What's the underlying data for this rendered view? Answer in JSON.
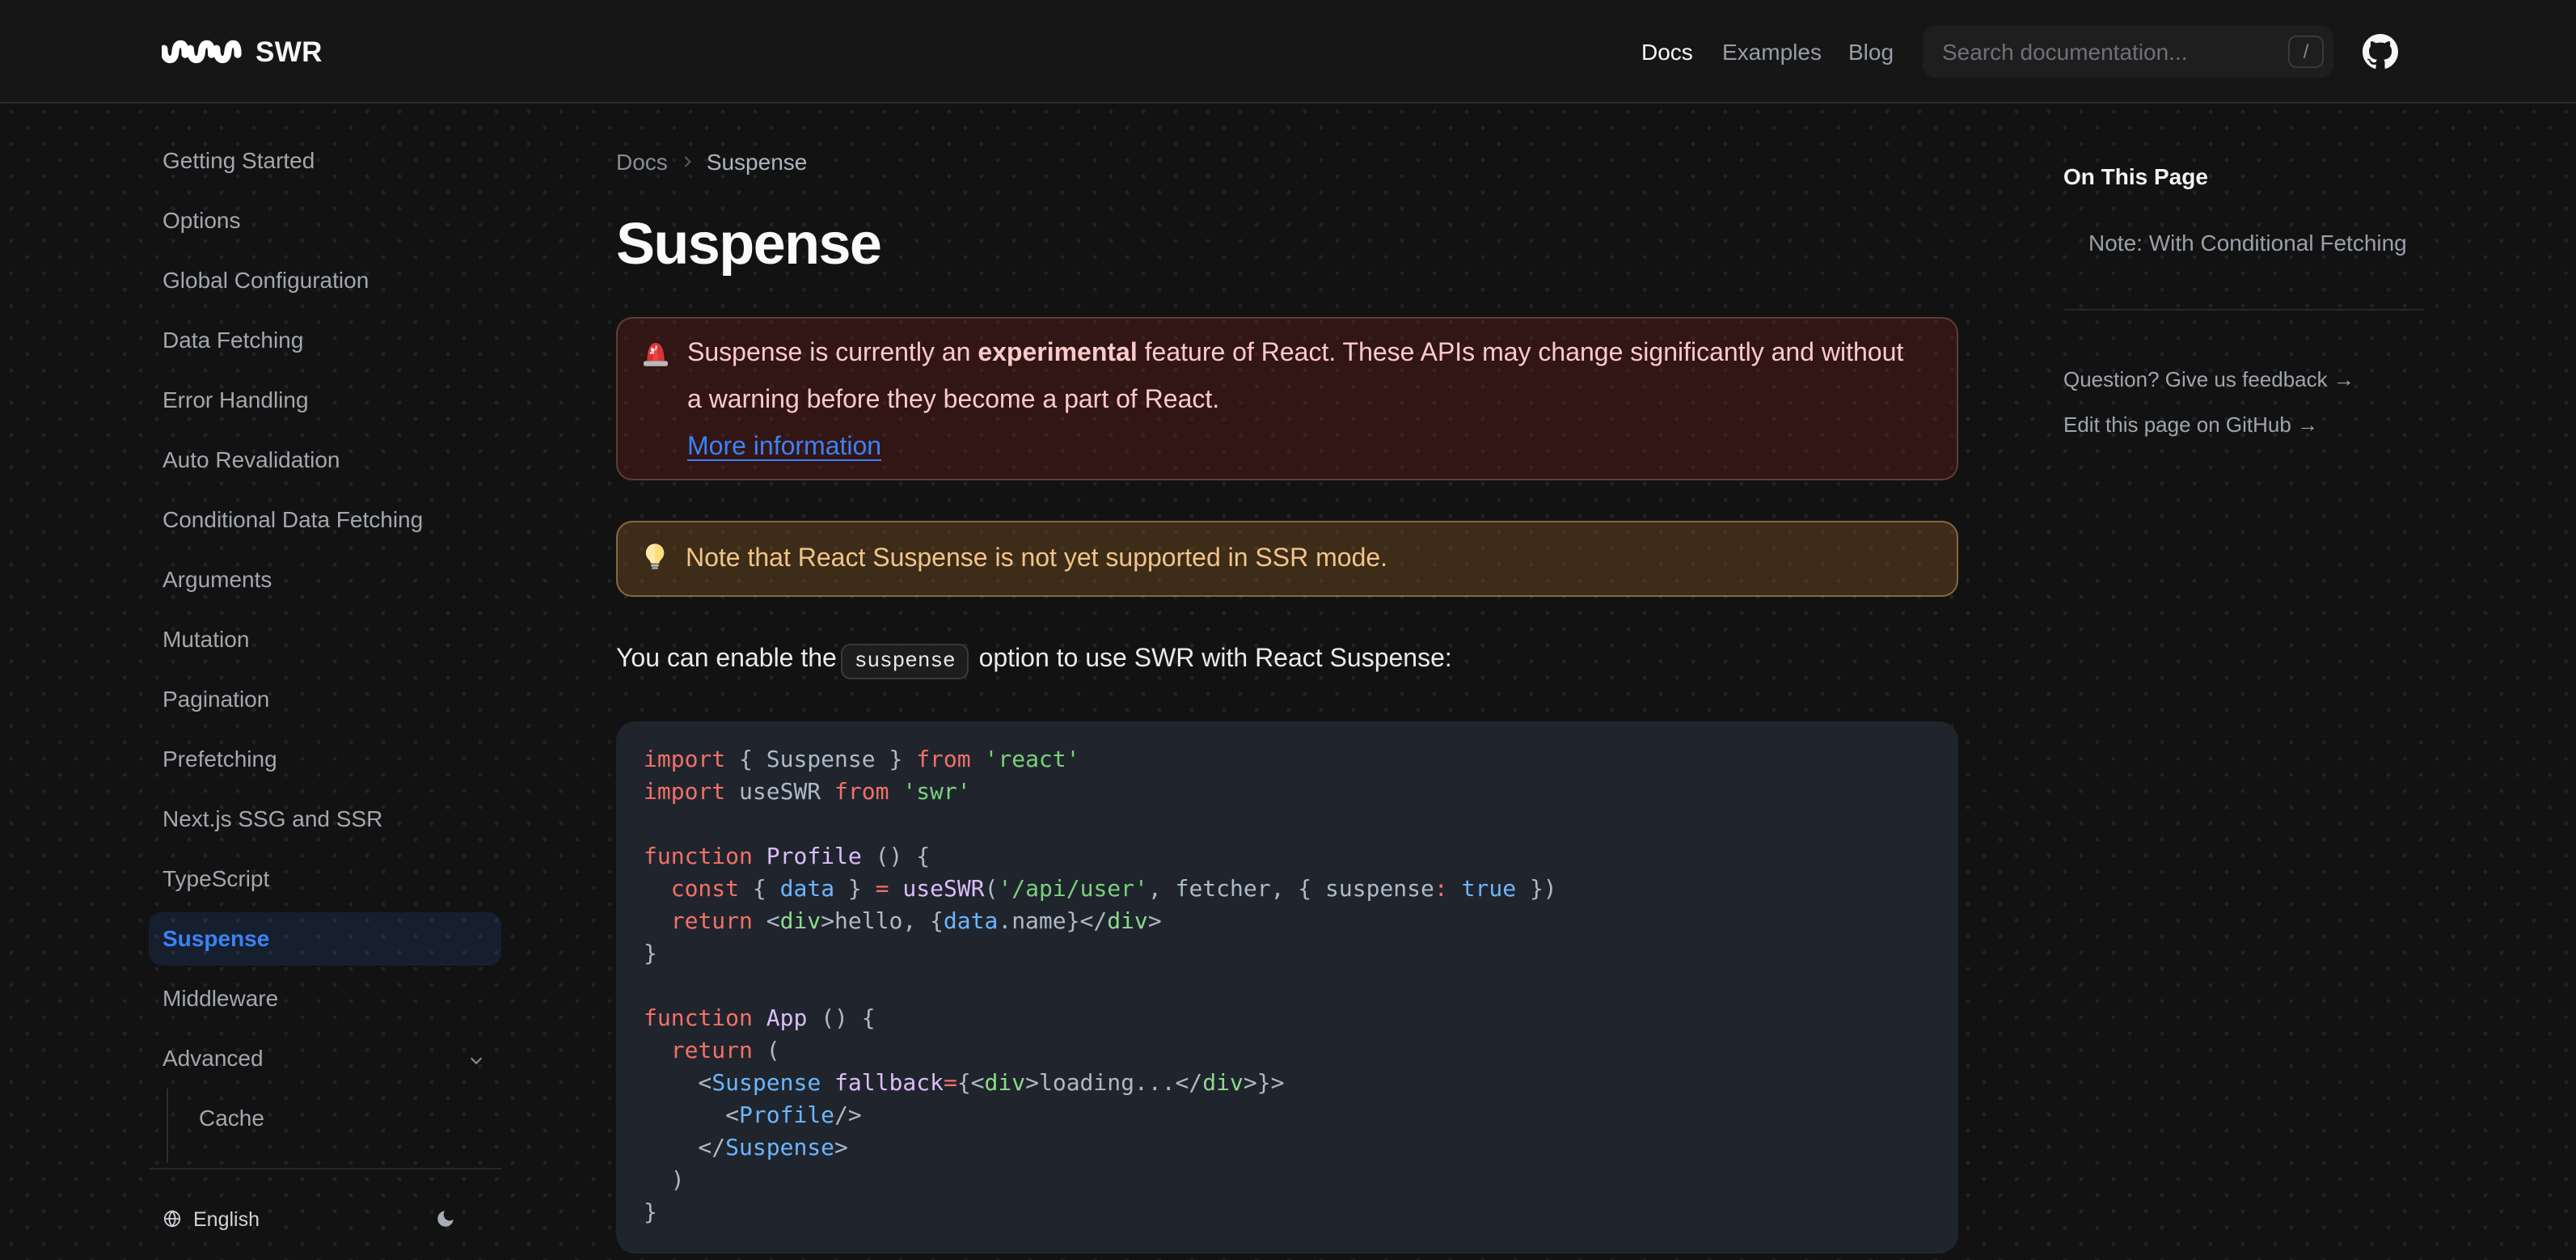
{
  "navbar": {
    "logo_text": "SWR",
    "links": [
      {
        "label": "Docs",
        "active": true
      },
      {
        "label": "Examples",
        "active": false
      },
      {
        "label": "Blog",
        "active": false
      }
    ],
    "search": {
      "placeholder": "Search documentation...",
      "kbd": "/"
    }
  },
  "sidebar": {
    "items": [
      {
        "label": "Getting Started"
      },
      {
        "label": "Options"
      },
      {
        "label": "Global Configuration"
      },
      {
        "label": "Data Fetching"
      },
      {
        "label": "Error Handling"
      },
      {
        "label": "Auto Revalidation"
      },
      {
        "label": "Conditional Data Fetching"
      },
      {
        "label": "Arguments"
      },
      {
        "label": "Mutation"
      },
      {
        "label": "Pagination"
      },
      {
        "label": "Prefetching"
      },
      {
        "label": "Next.js SSG and SSR"
      },
      {
        "label": "TypeScript"
      },
      {
        "label": "Suspense",
        "active": true
      },
      {
        "label": "Middleware"
      },
      {
        "label": "Advanced",
        "expandable": true
      }
    ],
    "nested_items": [
      {
        "label": "Cache"
      }
    ],
    "footer": {
      "language": "English"
    }
  },
  "breadcrumb": {
    "section": "Docs",
    "page": "Suspense"
  },
  "page": {
    "title": "Suspense"
  },
  "callouts": {
    "error": {
      "text_before": "Suspense is currently an ",
      "bold": "experimental",
      "text_after": " feature of React. These APIs may change significantly and without a warning before they become a part of React.",
      "link": "More information"
    },
    "warning": {
      "text": "Note that React Suspense is not yet supported in SSR mode."
    }
  },
  "paragraph": {
    "before": "You can enable the",
    "code": "suspense",
    "after": " option to use SWR with React Suspense:"
  },
  "code_block": {
    "lines": [
      [
        {
          "t": "import",
          "c": "kw"
        },
        {
          "t": " { Suspense } ",
          "c": "pl"
        },
        {
          "t": "from",
          "c": "kw"
        },
        {
          "t": " ",
          "c": "pl"
        },
        {
          "t": "'react'",
          "c": "str"
        }
      ],
      [
        {
          "t": "import",
          "c": "kw"
        },
        {
          "t": " useSWR ",
          "c": "pl"
        },
        {
          "t": "from",
          "c": "kw"
        },
        {
          "t": " ",
          "c": "pl"
        },
        {
          "t": "'swr'",
          "c": "str"
        }
      ],
      [],
      [
        {
          "t": "function",
          "c": "kw"
        },
        {
          "t": " ",
          "c": "pl"
        },
        {
          "t": "Profile",
          "c": "fn"
        },
        {
          "t": " () {",
          "c": "pl"
        }
      ],
      [
        {
          "t": "  ",
          "c": "pl"
        },
        {
          "t": "const",
          "c": "kw"
        },
        {
          "t": " { ",
          "c": "pl"
        },
        {
          "t": "data",
          "c": "num"
        },
        {
          "t": " } ",
          "c": "pl"
        },
        {
          "t": "=",
          "c": "kw"
        },
        {
          "t": " ",
          "c": "pl"
        },
        {
          "t": "useSWR",
          "c": "fn"
        },
        {
          "t": "(",
          "c": "pl"
        },
        {
          "t": "'/api/user'",
          "c": "str"
        },
        {
          "t": ", fetcher, { suspense",
          "c": "pl"
        },
        {
          "t": ":",
          "c": "kw"
        },
        {
          "t": " ",
          "c": "pl"
        },
        {
          "t": "true",
          "c": "num"
        },
        {
          "t": " })",
          "c": "pl"
        }
      ],
      [
        {
          "t": "  ",
          "c": "pl"
        },
        {
          "t": "return",
          "c": "kw"
        },
        {
          "t": " <",
          "c": "pl"
        },
        {
          "t": "div",
          "c": "tag"
        },
        {
          "t": ">hello, {",
          "c": "pl"
        },
        {
          "t": "data",
          "c": "num"
        },
        {
          "t": ".name}</",
          "c": "pl"
        },
        {
          "t": "div",
          "c": "tag"
        },
        {
          "t": ">",
          "c": "pl"
        }
      ],
      [
        {
          "t": "}",
          "c": "pl"
        }
      ],
      [],
      [
        {
          "t": "function",
          "c": "kw"
        },
        {
          "t": " ",
          "c": "pl"
        },
        {
          "t": "App",
          "c": "fn"
        },
        {
          "t": " () {",
          "c": "pl"
        }
      ],
      [
        {
          "t": "  ",
          "c": "pl"
        },
        {
          "t": "return",
          "c": "kw"
        },
        {
          "t": " (",
          "c": "pl"
        }
      ],
      [
        {
          "t": "    <",
          "c": "pl"
        },
        {
          "t": "Suspense",
          "c": "cmp"
        },
        {
          "t": " ",
          "c": "pl"
        },
        {
          "t": "fallback",
          "c": "attr"
        },
        {
          "t": "=",
          "c": "kw"
        },
        {
          "t": "{<",
          "c": "pl"
        },
        {
          "t": "div",
          "c": "tag"
        },
        {
          "t": ">loading...</",
          "c": "pl"
        },
        {
          "t": "div",
          "c": "tag"
        },
        {
          "t": ">}>",
          "c": "pl"
        }
      ],
      [
        {
          "t": "      <",
          "c": "pl"
        },
        {
          "t": "Profile",
          "c": "cmp"
        },
        {
          "t": "/>",
          "c": "pl"
        }
      ],
      [
        {
          "t": "    </",
          "c": "pl"
        },
        {
          "t": "Suspense",
          "c": "cmp"
        },
        {
          "t": ">",
          "c": "pl"
        }
      ],
      [
        {
          "t": "  )",
          "c": "pl"
        }
      ],
      [
        {
          "t": "}",
          "c": "pl"
        }
      ]
    ]
  },
  "toc": {
    "heading": "On This Page",
    "items": [
      "Note: With Conditional Fetching"
    ],
    "links": [
      "Question? Give us feedback →",
      "Edit this page on GitHub →"
    ]
  },
  "colors": {
    "accent": "#3b82f6",
    "error_text": "#fecaca",
    "warning_text": "#f3c584",
    "background": "#111111"
  }
}
